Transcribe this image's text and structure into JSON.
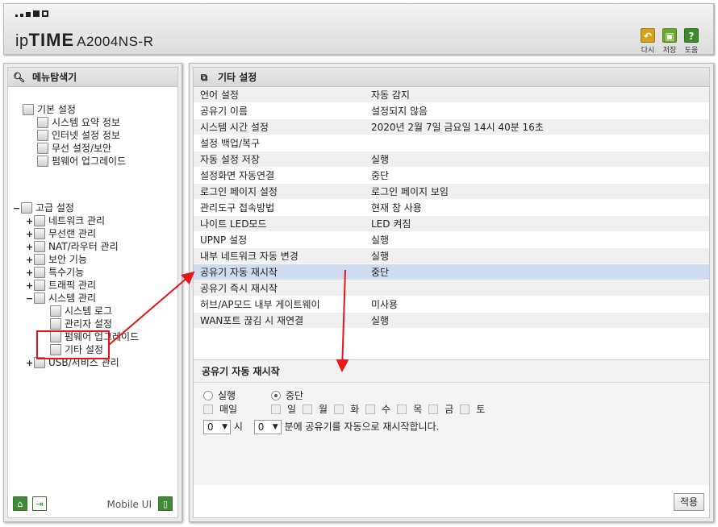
{
  "header": {
    "brand_prefix": "ip",
    "brand_bold": "TIME",
    "model": "A2004NS-R",
    "buttons": [
      {
        "label": "다시",
        "icon": "undo-icon",
        "color": "#d7a21b"
      },
      {
        "label": "저장",
        "icon": "save-icon",
        "color": "#6aa82a"
      },
      {
        "label": "도움",
        "icon": "help-icon",
        "color": "#3c8c2e"
      }
    ]
  },
  "sidebar": {
    "title": "메뉴탐색기",
    "basic": {
      "label": "기본 설정",
      "items": [
        "시스템 요약 정보",
        "인터넷 설정 정보",
        "무선 설정/보안",
        "펌웨어 업그레이드"
      ]
    },
    "advanced": {
      "label": "고급 설정",
      "items": [
        "네트워크 관리",
        "무선랜 관리",
        "NAT/라우터 관리",
        "보안 기능",
        "특수기능",
        "트래픽 관리",
        "시스템 관리"
      ],
      "system_children": [
        "시스템 로그",
        "관리자 설정",
        "펌웨어 업그레이드",
        "기타 설정"
      ],
      "last_item": "USB/서비스 관리"
    },
    "footer": {
      "mobile_label": "Mobile UI"
    }
  },
  "main": {
    "title": "기타 설정",
    "rows": [
      {
        "key": "언어 설정",
        "value": "자동 감지"
      },
      {
        "key": "공유기 이름",
        "value": "설정되지 않음"
      },
      {
        "key": "시스템 시간 설정",
        "value": "2020년 2월 7일 금요일 14시 40분 16초"
      },
      {
        "key": "설정 백업/복구",
        "value": ""
      },
      {
        "key": "자동 설정 저장",
        "value": "실행"
      },
      {
        "key": "설정화면 자동연결",
        "value": "중단"
      },
      {
        "key": "로그인 페이지 설정",
        "value": "로그인 페이지 보임"
      },
      {
        "key": "관리도구 접속방법",
        "value": "현재 창 사용"
      },
      {
        "key": "나이트 LED모드",
        "value": "LED 켜짐"
      },
      {
        "key": "UPNP 설정",
        "value": "실행"
      },
      {
        "key": "내부 네트워크 자동 변경",
        "value": "실행"
      },
      {
        "key": "공유기 자동 재시작",
        "value": "중단",
        "selected": true
      },
      {
        "key": "공유기 즉시 재시작",
        "value": ""
      },
      {
        "key": "허브/AP모드 내부 게이트웨이",
        "value": "미사용"
      },
      {
        "key": "WAN포트 끊김 시 재연결",
        "value": "실행"
      }
    ],
    "detail": {
      "title": "공유기 자동 재시작",
      "radio_run": "실행",
      "radio_stop": "중단",
      "radio_selected": "중단",
      "daily": "매일",
      "days": [
        "일",
        "월",
        "화",
        "수",
        "목",
        "금",
        "토"
      ],
      "hour_value": "0",
      "hour_unit": "시",
      "minute_value": "0",
      "minute_suffix": "분에 공유기를 자동으로 재시작합니다.",
      "apply_label": "적용"
    }
  },
  "colors": {
    "selected_row": "#cfdcef",
    "annotation": "#e8141a"
  }
}
